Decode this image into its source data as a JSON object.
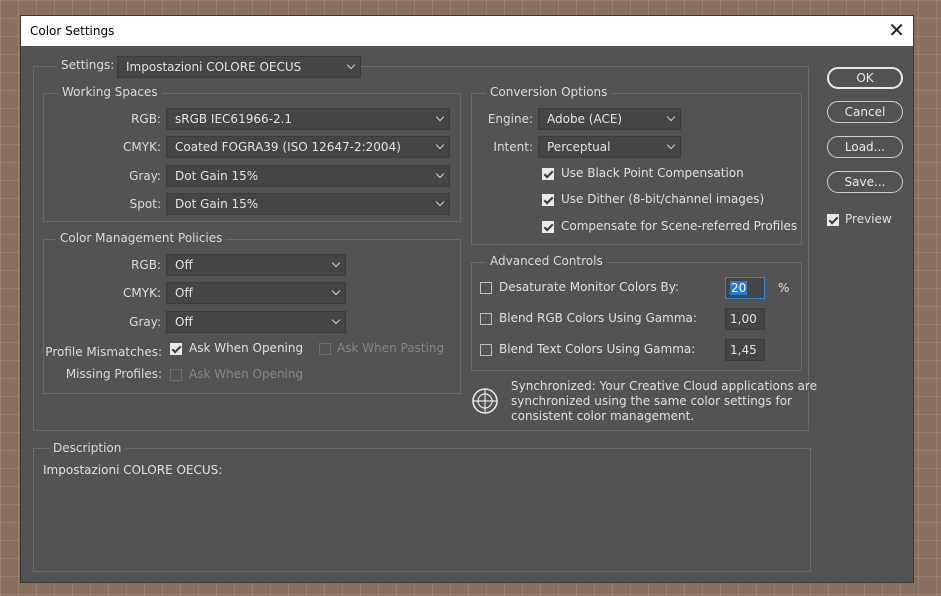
{
  "dialog": {
    "title": "Color Settings",
    "close_glyph": "✕"
  },
  "settings": {
    "label": "Settings:",
    "value": "Impostazioni COLORE OECUS"
  },
  "working_spaces": {
    "title": "Working Spaces",
    "rgb_label": "RGB:",
    "rgb_value": "sRGB IEC61966-2.1",
    "cmyk_label": "CMYK:",
    "cmyk_value": "Coated FOGRA39 (ISO 12647-2:2004)",
    "gray_label": "Gray:",
    "gray_value": "Dot Gain 15%",
    "spot_label": "Spot:",
    "spot_value": "Dot Gain 15%"
  },
  "policies": {
    "title": "Color Management Policies",
    "rgb_label": "RGB:",
    "rgb_value": "Off",
    "cmyk_label": "CMYK:",
    "cmyk_value": "Off",
    "gray_label": "Gray:",
    "gray_value": "Off",
    "mismatch_label": "Profile Mismatches:",
    "ask_opening": "Ask When Opening",
    "ask_pasting": "Ask When Pasting",
    "missing_label": "Missing Profiles:",
    "missing_ask_opening": "Ask When Opening"
  },
  "conversion": {
    "title": "Conversion Options",
    "engine_label": "Engine:",
    "engine_value": "Adobe (ACE)",
    "intent_label": "Intent:",
    "intent_value": "Perceptual",
    "black_point": "Use Black Point Compensation",
    "dither": "Use Dither (8-bit/channel images)",
    "scene_referred": "Compensate for Scene-referred Profiles"
  },
  "advanced": {
    "title": "Advanced Controls",
    "desaturate": "Desaturate Monitor Colors By:",
    "desaturate_value": "20",
    "desaturate_unit": "%",
    "blend_rgb": "Blend RGB Colors Using Gamma:",
    "blend_rgb_value": "1,00",
    "blend_text": "Blend Text Colors Using Gamma:",
    "blend_text_value": "1,45"
  },
  "sync": {
    "icon": "sync-globe-icon",
    "line1": "Synchronized: Your Creative Cloud applications are",
    "line2": "synchronized using the same color settings for",
    "line3": "consistent color management."
  },
  "description": {
    "title": "Description",
    "text": "Impostazioni COLORE OECUS:"
  },
  "buttons": {
    "ok": "OK",
    "cancel": "Cancel",
    "load": "Load...",
    "save": "Save...",
    "preview": "Preview"
  }
}
